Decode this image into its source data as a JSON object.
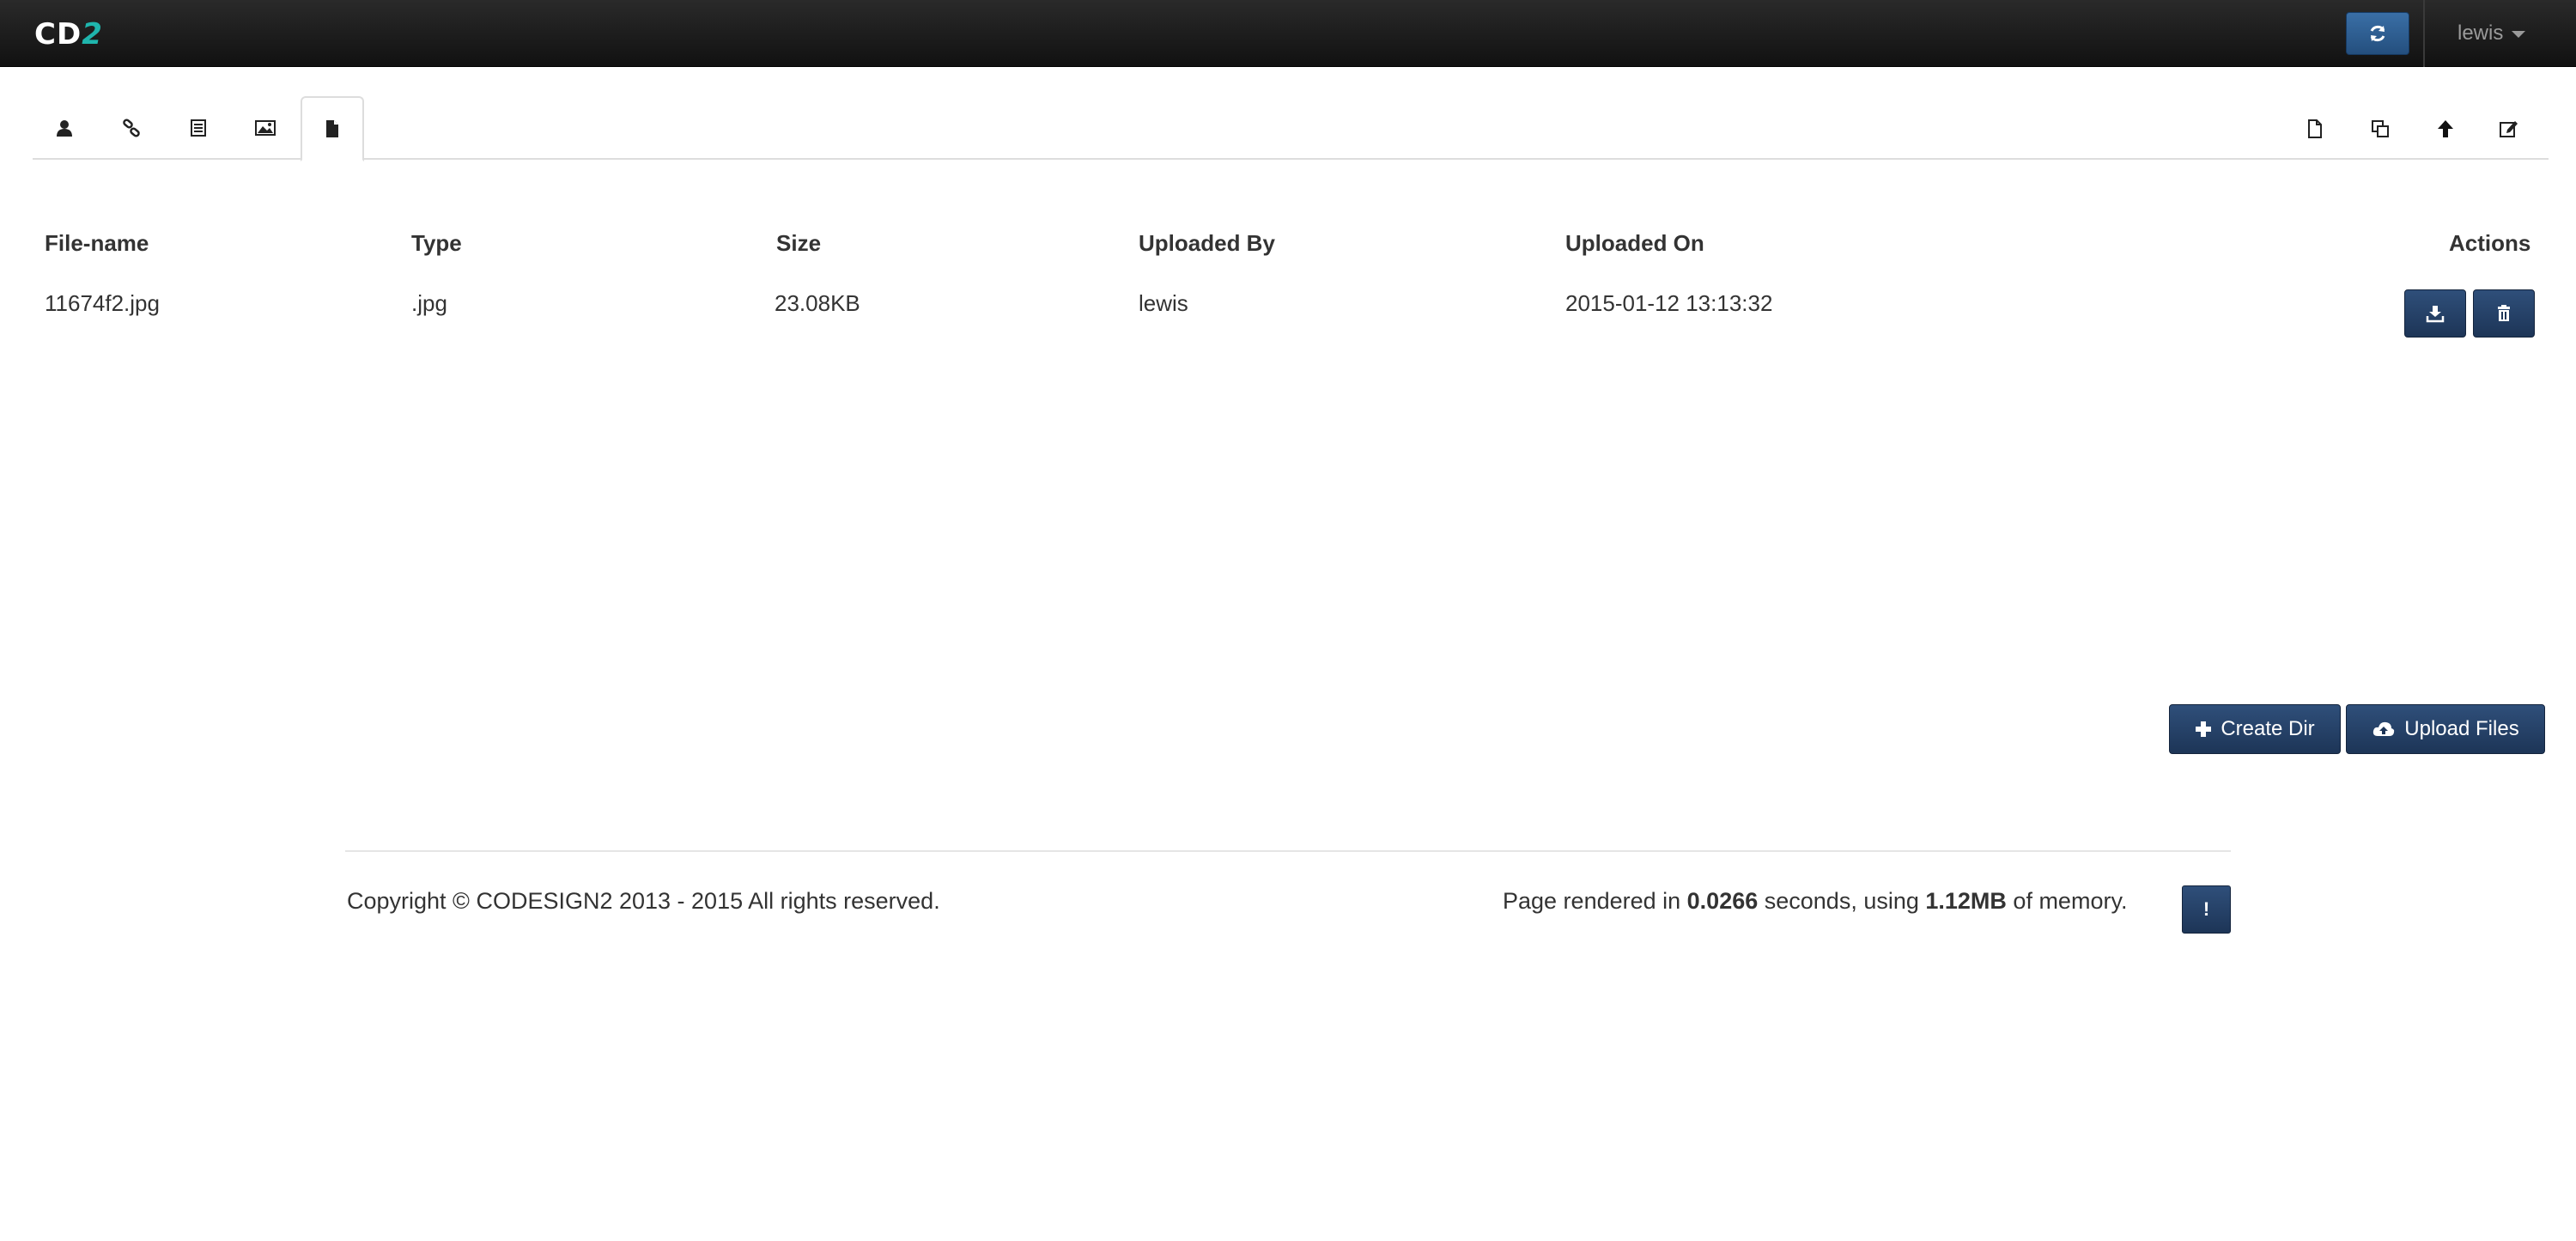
{
  "app": {
    "brand_main": "CD",
    "brand_accent": "2",
    "accent_color": "#1fb5ad"
  },
  "navbar": {
    "refresh_icon": "refresh-icon",
    "user_name": "lewis"
  },
  "tabs": [
    {
      "icon": "user-icon",
      "active": false
    },
    {
      "icon": "link-icon",
      "active": false
    },
    {
      "icon": "list-icon",
      "active": false
    },
    {
      "icon": "image-icon",
      "active": false
    },
    {
      "icon": "file-icon",
      "active": true
    }
  ],
  "toolbar": [
    {
      "icon": "new-file-icon"
    },
    {
      "icon": "copy-icon"
    },
    {
      "icon": "arrow-up-icon"
    },
    {
      "icon": "edit-icon"
    }
  ],
  "table": {
    "headers": {
      "filename": "File-name",
      "type": "Type",
      "size": "Size",
      "uploaded_by": "Uploaded By",
      "uploaded_on": "Uploaded On",
      "actions": "Actions"
    },
    "rows": [
      {
        "filename": "11674f2.jpg",
        "type": ".jpg",
        "size": "23.08KB",
        "uploaded_by": "lewis",
        "uploaded_on": "2015-01-12 13:13:32",
        "actions": [
          "download-icon",
          "trash-icon"
        ]
      }
    ]
  },
  "actions": {
    "create_dir": "Create Dir",
    "upload_files": "Upload Files"
  },
  "footer": {
    "copyright": "Copyright © CODESIGN2 2013 - 2015 All rights reserved.",
    "render_prefix": "Page rendered in ",
    "render_time": "0.0266",
    "render_middle": " seconds, using ",
    "render_memory": "1.12MB",
    "render_suffix": " of memory.",
    "info_label": "!"
  }
}
